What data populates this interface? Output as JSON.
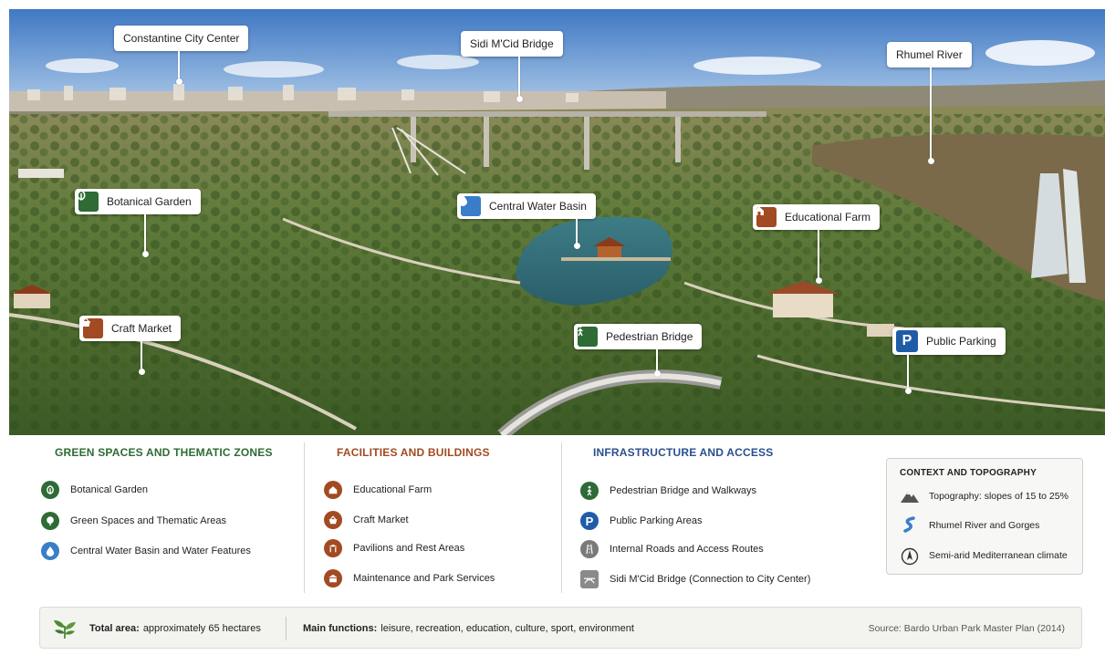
{
  "colors": {
    "green": "#2e6b35",
    "brown": "#a24a22",
    "blue_accent": "#2b4f8e",
    "water": "#3a7ec8",
    "parking": "#1f5ca8",
    "gray": "#7a7a7a"
  },
  "callouts": {
    "constantine": "Constantine City Center",
    "sidi_mcid": "Sidi M'Cid Bridge",
    "rhumel": "Rhumel River",
    "botanical": "Botanical Garden",
    "water_basin": "Central Water Basin",
    "edu_farm": "Educational Farm",
    "craft_market": "Craft Market",
    "ped_bridge": "Pedestrian Bridge",
    "public_parking": "Public Parking",
    "parking_letter": "P"
  },
  "legend": {
    "green": {
      "title": "GREEN SPACES AND THEMATIC ZONES",
      "items": [
        {
          "label": "Botanical Garden",
          "icon": "leaf-icon"
        },
        {
          "label": "Green Spaces and Thematic Areas",
          "icon": "tree-icon"
        },
        {
          "label": "Central Water Basin and Water Features",
          "icon": "water-drop-icon"
        }
      ]
    },
    "facilities": {
      "title": "FACILITIES AND BUILDINGS",
      "items": [
        {
          "label": "Educational Farm",
          "icon": "farm-house-icon"
        },
        {
          "label": "Craft Market",
          "icon": "basket-icon"
        },
        {
          "label": "Pavilions and Rest Areas",
          "icon": "pavilion-icon"
        },
        {
          "label": "Maintenance and Park Services",
          "icon": "building-icon"
        }
      ]
    },
    "infrastructure": {
      "title": "INFRASTRUCTURE AND ACCESS",
      "items": [
        {
          "label": "Pedestrian Bridge and Walkways",
          "icon": "pedestrian-icon"
        },
        {
          "label": "Public Parking Areas",
          "icon": "parking-icon"
        },
        {
          "label": "Internal Roads and Access Routes",
          "icon": "road-icon"
        },
        {
          "label": "Sidi M'Cid Bridge (Connection to City Center)",
          "icon": "bridge-icon"
        }
      ]
    },
    "context": {
      "title": "CONTEXT AND TOPOGRAPHY",
      "items": [
        {
          "label": "Topography: slopes of 15 to 25%",
          "icon": "mountain-icon"
        },
        {
          "label": "Rhumel River and Gorges",
          "icon": "river-icon"
        },
        {
          "label": "Semi-arid Mediterranean climate",
          "icon": "compass-icon"
        }
      ]
    }
  },
  "footer": {
    "area_label": "Total area:",
    "area_value": "approximately 65 hectares",
    "functions_label": "Main functions:",
    "functions_value": "leisure, recreation, education, culture, sport, environment",
    "source": "Source: Bardo Urban Park Master Plan (2014)"
  }
}
